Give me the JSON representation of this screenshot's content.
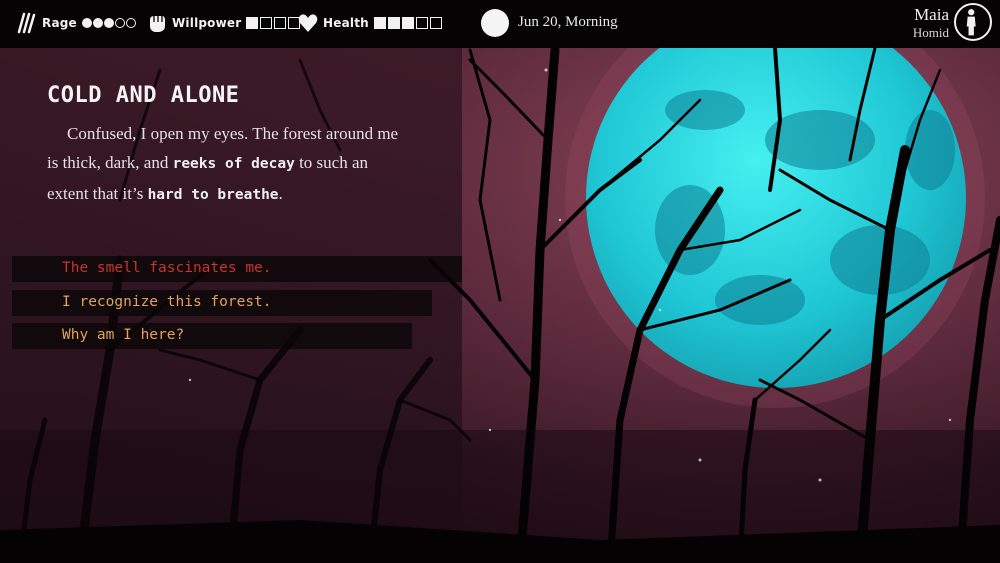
{
  "hud": {
    "stats": [
      {
        "label": "Rage",
        "icon": "claw-marks-icon",
        "pip_style": "circle",
        "filled": 3,
        "total": 5
      },
      {
        "label": "Willpower",
        "icon": "fist-icon",
        "pip_style": "square",
        "filled": 1,
        "total": 4
      },
      {
        "label": "Health",
        "icon": "heart-icon",
        "pip_style": "square",
        "filled": 3,
        "total": 5
      }
    ],
    "moon_phase_icon": "full-moon-icon",
    "date": "Jun 20, Morning",
    "character": {
      "name": "Maia",
      "form": "Homid",
      "avatar_icon": "human-silhouette-icon"
    }
  },
  "story": {
    "title": "COLD AND ALONE",
    "text_parts": [
      {
        "text": "Confused, I open my eyes. The forest around me is thick, dark, and ",
        "style": "serif"
      },
      {
        "text": "reeks of decay",
        "style": "mono"
      },
      {
        "text": " to such an extent that it’s ",
        "style": "serif"
      },
      {
        "text": "hard to breathe",
        "style": "mono"
      },
      {
        "text": ".",
        "style": "serif"
      }
    ],
    "choices": [
      {
        "label": "The smell fascinates me.",
        "color": "#c9352c"
      },
      {
        "label": "I recognize this forest.",
        "color": "#e3a35a"
      },
      {
        "label": "Why am I here?",
        "color": "#e3a35a"
      }
    ]
  },
  "colors": {
    "sky_dark": "#3a1a26",
    "sky_mid": "#7a3a50",
    "moon": "#2fd9e0",
    "rage_choice": "#c9352c",
    "normal_choice": "#e3a35a"
  }
}
